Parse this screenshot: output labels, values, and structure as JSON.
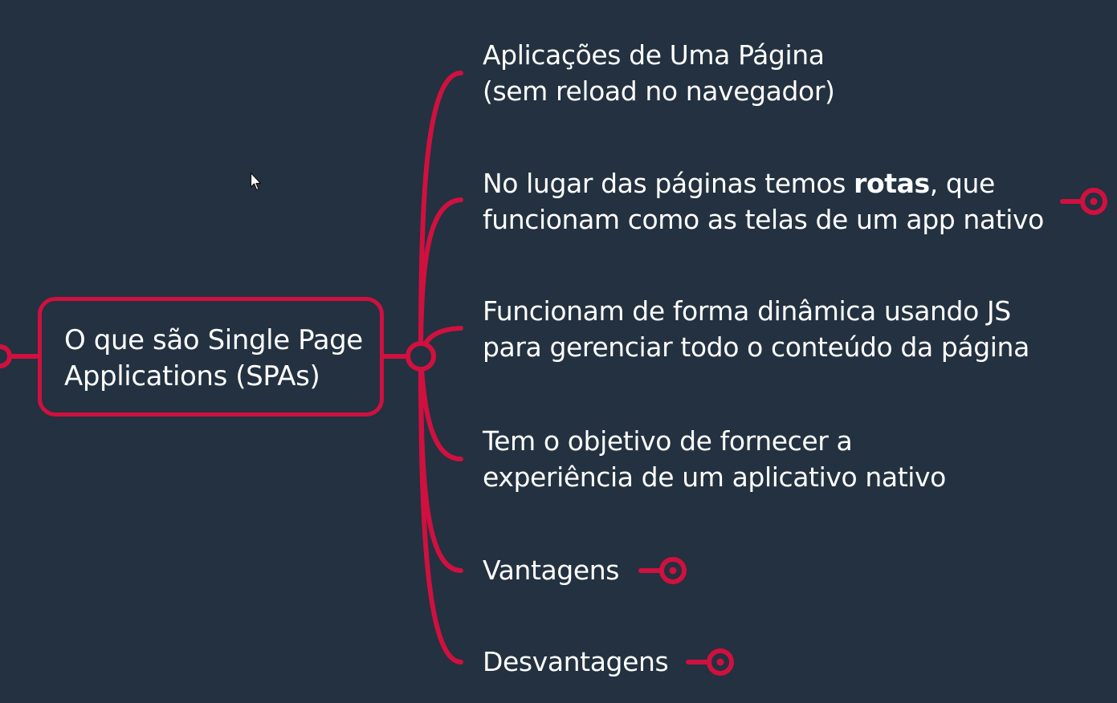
{
  "central_topic": {
    "line1": "O que são Single Page",
    "line2": "Applications (SPAs)"
  },
  "branches": [
    {
      "line1": "Aplicações de Uma Página",
      "line2": "(sem reload no navegador)",
      "collapsed": false
    },
    {
      "line1_before": "No lugar das páginas temos ",
      "line1_bold": "rotas",
      "line1_after": ", que",
      "line2": "funcionam como as telas de um app nativo",
      "collapsed": true
    },
    {
      "line1": "Funcionam de forma dinâmica usando JS",
      "line2": "para gerenciar todo o conteúdo da página",
      "collapsed": false
    },
    {
      "line1": "Tem o objetivo de fornecer a",
      "line2": "experiência de um aplicativo nativo",
      "collapsed": false
    },
    {
      "line1": "Vantagens",
      "collapsed": true
    },
    {
      "line1": "Desvantagens",
      "collapsed": true
    }
  ],
  "colors": {
    "background": "#233140",
    "accent": "#d0103f",
    "text": "#ffffff"
  },
  "icons": {
    "collapsed_marker": "expand-branch-icon",
    "cursor": "mouse-pointer-icon"
  }
}
